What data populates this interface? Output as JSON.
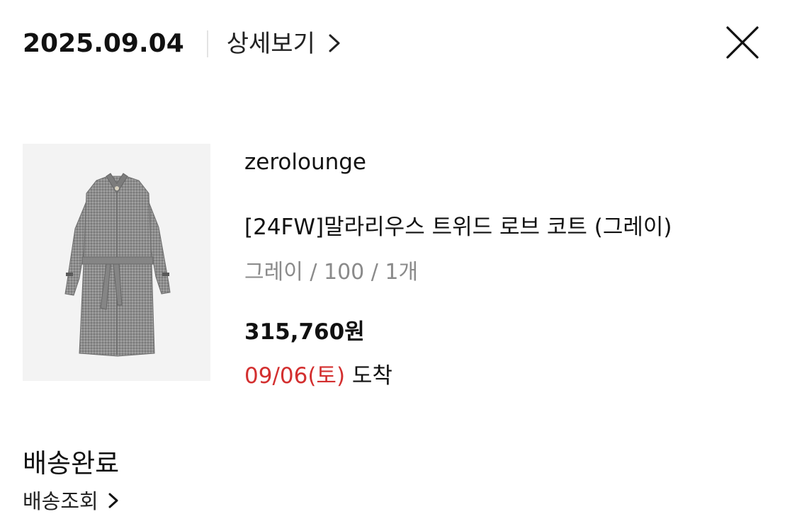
{
  "header": {
    "order_date": "2025.09.04",
    "detail_label": "상세보기"
  },
  "product": {
    "brand": "zerolounge",
    "name": "[24FW]말라리우스 트위드 로브 코트 (그레이)",
    "option": "그레이 / 100 / 1개",
    "price": "315,760원",
    "arrival_date": "09/06(토)",
    "arrival_suffix": " 도착",
    "image_icon": "gray-tweed-coat-image"
  },
  "status": {
    "title": "배송완료",
    "tracking_label": "배송조회"
  },
  "colors": {
    "arrival_accent": "#d32f2f",
    "option_text": "#8a8a8a",
    "image_background": "#f3f3f3"
  }
}
